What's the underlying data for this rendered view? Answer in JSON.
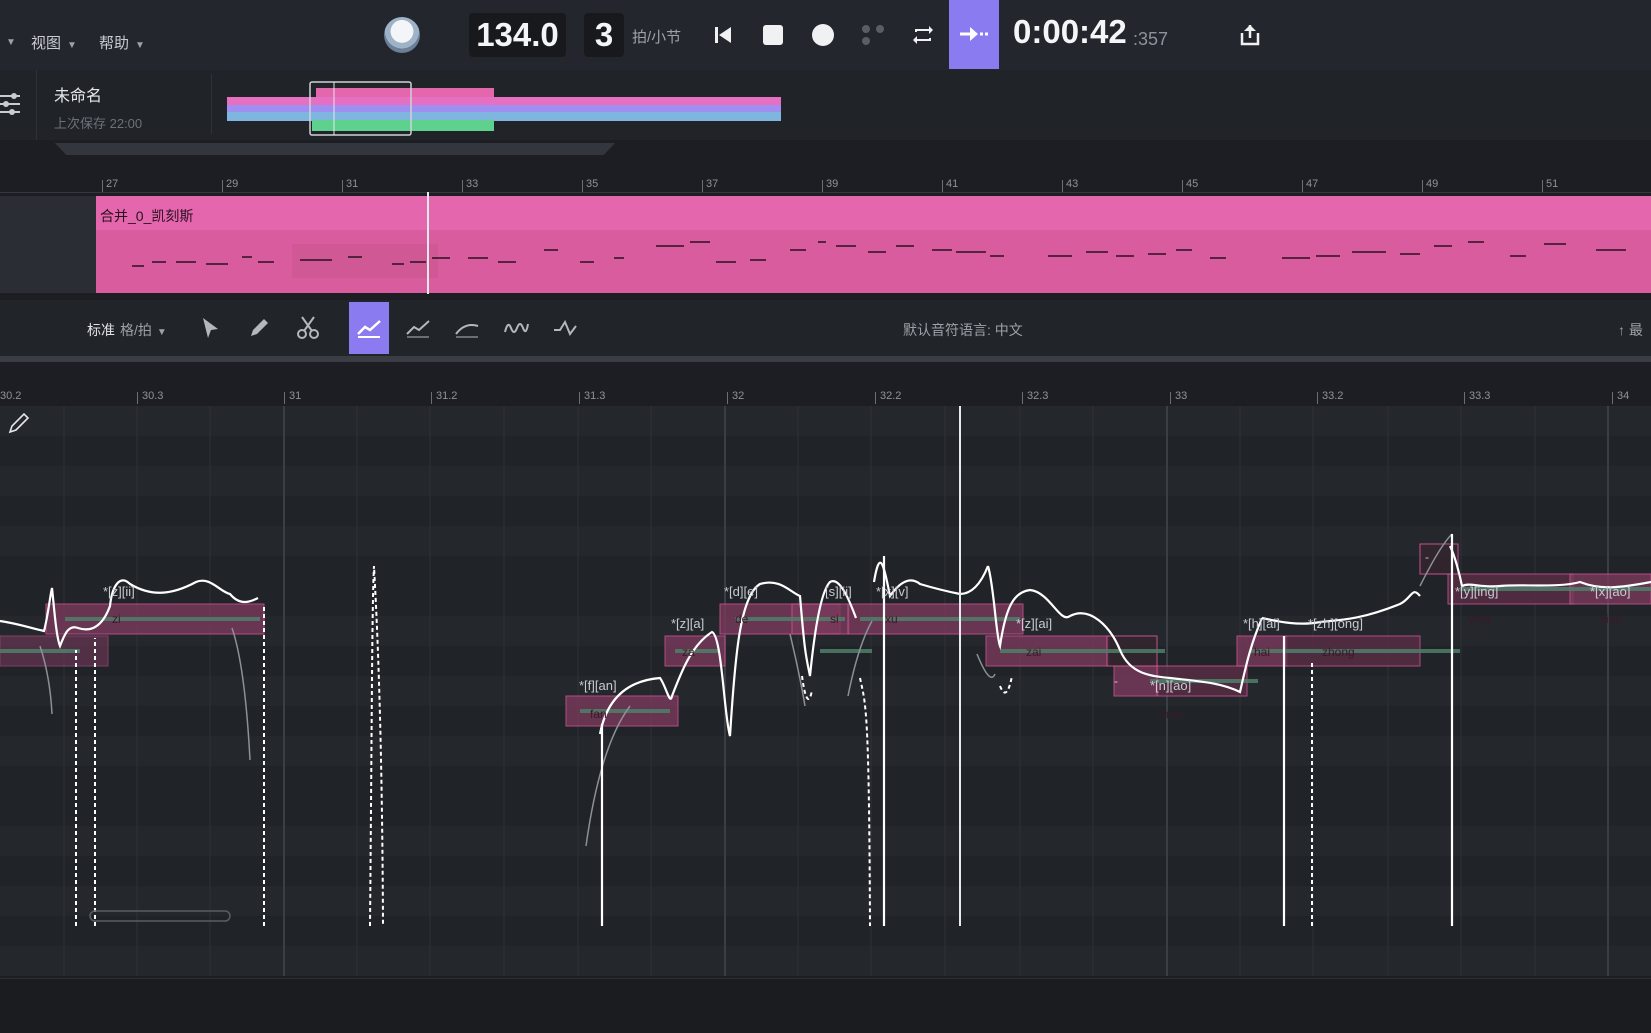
{
  "menu": {
    "view": "视图",
    "help": "帮助"
  },
  "transport": {
    "tempo": "134.0",
    "beats": "3",
    "beats_unit": "拍/小节",
    "time_main": "0:00:42",
    "time_ms": ":357"
  },
  "project": {
    "title": "未命名",
    "saved": "上次保存 22:00"
  },
  "arrangement": {
    "bar_labels": [
      "27",
      "29",
      "31",
      "33",
      "35",
      "37",
      "39",
      "41",
      "43",
      "45",
      "47",
      "49",
      "51"
    ],
    "track_name": "合并_0_凯刻斯"
  },
  "editor_toolbar": {
    "quantize": "标准",
    "quantize_unit": "格/拍",
    "language": "默认音符语言: 中文",
    "right_label": "最"
  },
  "pianoroll": {
    "bar_labels": [
      "30.2",
      "30.3",
      "31",
      "31.2",
      "31.3",
      "32",
      "32.2",
      "32.3",
      "33",
      "33.2",
      "33.3",
      "34"
    ],
    "notes": [
      {
        "phoneme": "*[z][ii]",
        "lyric": "zi"
      },
      {
        "phoneme": "*[f][an]",
        "lyric": "fan"
      },
      {
        "phoneme": "*[z][a]",
        "lyric": "za"
      },
      {
        "phoneme": "*[d][e]",
        "lyric": "de"
      },
      {
        "phoneme": "[s][ii]",
        "lyric": "si"
      },
      {
        "phoneme": "*[x][v]",
        "lyric": "xu"
      },
      {
        "phoneme": "*[z][ai]",
        "lyric": "zai"
      },
      {
        "phoneme": "*[n][ao]",
        "lyric": "nao"
      },
      {
        "phoneme": "*[h][ai]",
        "lyric": "hai"
      },
      {
        "phoneme": "*[zh][ong]",
        "lyric": "zhong"
      },
      {
        "phoneme": "*[y][ing]",
        "lyric": "ying"
      },
      {
        "phoneme": "*[x][ao]",
        "lyric": "xiao"
      }
    ],
    "dash_label": "-"
  },
  "colors": {
    "accent": "#8a7cf0",
    "track": "#e466ad",
    "note_fill": "#7a3a5c",
    "note_border": "#d7559a"
  }
}
